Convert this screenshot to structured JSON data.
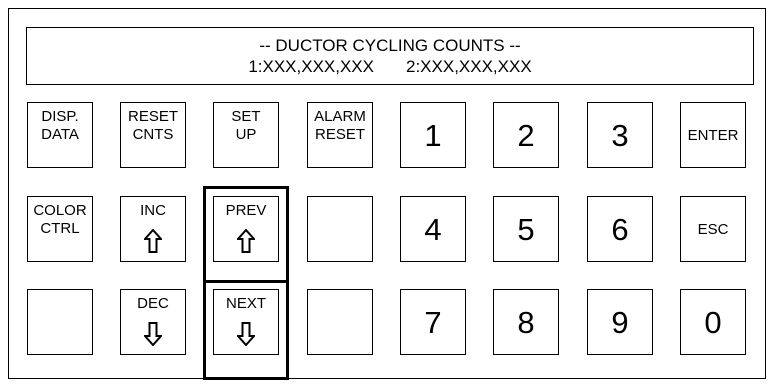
{
  "display": {
    "title": "-- DUCTOR CYCLING COUNTS --",
    "count1": "1:XXX,XXX,XXX",
    "count2": "2:XXX,XXX,XXX"
  },
  "keys": {
    "disp_data": "DISP.\nDATA",
    "reset_cnts": "RESET\nCNTS",
    "set_up": "SET\nUP",
    "alarm_reset": "ALARM\nRESET",
    "enter": "ENTER",
    "color_ctrl": "COLOR\nCTRL",
    "inc": "INC",
    "prev": "PREV",
    "esc": "ESC",
    "dec": "DEC",
    "next": "NEXT",
    "d1": "1",
    "d2": "2",
    "d3": "3",
    "d4": "4",
    "d5": "5",
    "d6": "6",
    "d7": "7",
    "d8": "8",
    "d9": "9",
    "d0": "0"
  },
  "icons": {
    "up_arrow": "up-arrow-icon",
    "down_arrow": "down-arrow-icon"
  },
  "highlighted_keys": [
    "prev",
    "next"
  ]
}
